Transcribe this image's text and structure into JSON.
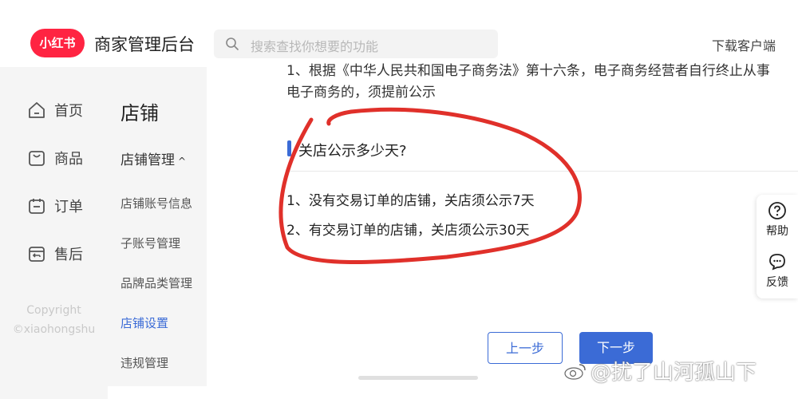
{
  "header": {
    "logo_text": "小红书",
    "title": "商家管理后台",
    "search_placeholder": "搜索查找你想要的功能",
    "download_label": "下载客户端"
  },
  "nav_primary": [
    {
      "label": "首页",
      "icon": "home-icon"
    },
    {
      "label": "商品",
      "icon": "bag-icon"
    },
    {
      "label": "订单",
      "icon": "order-icon"
    },
    {
      "label": "售后",
      "icon": "aftersale-icon"
    }
  ],
  "copyright": {
    "line1": "Copyright",
    "line2": "©xiaohongshu"
  },
  "nav_secondary": {
    "title": "店铺",
    "group": "店铺管理",
    "items": [
      "店铺账号信息",
      "子账号管理",
      "品牌品类管理",
      "店铺设置",
      "违规管理"
    ],
    "active_index": 3
  },
  "content": {
    "intro_text": "1、根据《中华人民共和国电子商务法》第十六条，电子商务经营者自行终止从事电子商务的，须提前公示",
    "section_title": "关店公示多少天?",
    "lines": [
      "1、没有交易订单的店铺，关店须公示7天",
      "2、有交易订单的店铺，关店须公示30天"
    ],
    "prev_button": "上一步",
    "next_button": "下一步"
  },
  "float_panel": {
    "help_label": "帮助",
    "feedback_label": "反馈"
  },
  "watermark": "@扰了山河孤山下",
  "colors": {
    "brand": "#ff2442",
    "accent": "#3b6bd6",
    "annotation": "#e0302a"
  }
}
